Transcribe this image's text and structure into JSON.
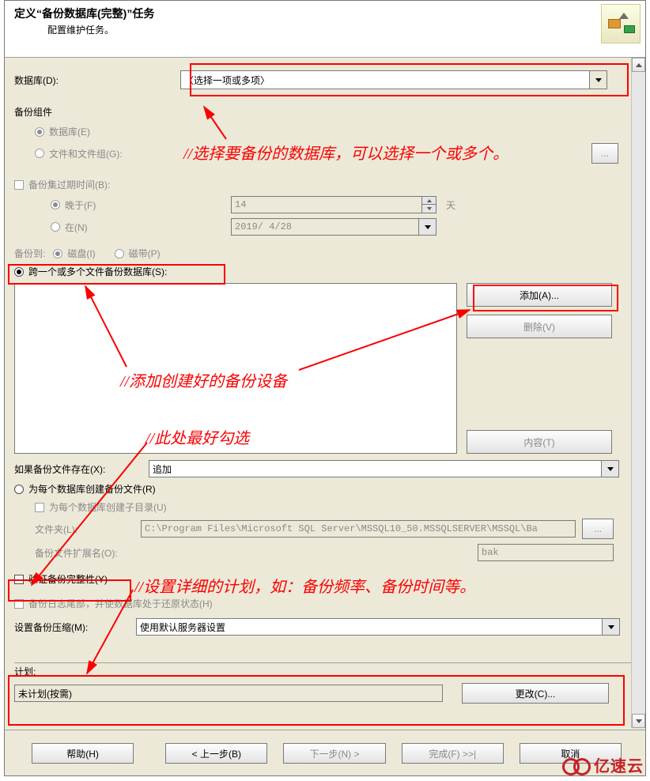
{
  "header": {
    "title": "定义“备份数据库(完整)”任务",
    "subtitle": "配置维护任务。"
  },
  "database": {
    "label": "数据库(D):",
    "value": "〈选择一项或多项〉"
  },
  "backup_component": {
    "group_label": "备份组件",
    "opt_database": "数据库(E)",
    "opt_files": "文件和文件组(G):"
  },
  "expire": {
    "label": "备份集过期时间(B):",
    "opt_after": "晚于(F)",
    "opt_on": "在(N)",
    "days_value": "14",
    "days_unit": "天",
    "date_value": "2019/ 4/28"
  },
  "backup_to": {
    "label": "备份到:",
    "opt_disk": "磁盘(I)",
    "opt_tape": "磁带(P)"
  },
  "dest": {
    "opt_across": "跨一个或多个文件备份数据库(S):",
    "btn_add": "添加(A)...",
    "btn_remove": "删除(V)",
    "btn_content": "内容(T)"
  },
  "if_exists": {
    "label": "如果备份文件存在(X):",
    "value": "追加"
  },
  "per_db": {
    "opt": "为每个数据库创建备份文件(R)",
    "subdir": "为每个数据库创建子目录(U)",
    "folder_label": "文件夹(L):",
    "folder_value": "C:\\Program Files\\Microsoft SQL Server\\MSSQL10_50.MSSQLSERVER\\MSSQL\\Ba",
    "folder_btn": "...",
    "ext_label": "备份文件扩展名(O):",
    "ext_value": "bak"
  },
  "verify": {
    "label": "验证备份完整性(Y)"
  },
  "tail": {
    "label": "备份日志尾部，并使数据库处于还原状态(H)"
  },
  "compression": {
    "label": "设置备份压缩(M):",
    "value": "使用默认服务器设置"
  },
  "schedule": {
    "label": "计划:",
    "value": "未计划(按需)",
    "btn_change": "更改(C)..."
  },
  "buttons": {
    "help": "帮助(H)",
    "back": "< 上一步(B)",
    "next": "下一步(N) >",
    "finish": "完成(F) >>|",
    "cancel": "取消"
  },
  "annotations": {
    "a1": "//选择要备份的数据库，可以选择一个或多个。",
    "a2": "//添加创建好的备份设备",
    "a3": "//此处最好勾选",
    "a4": "//设置详细的计划，如：备份频率、备份时间等。"
  },
  "watermark": "亿速云"
}
